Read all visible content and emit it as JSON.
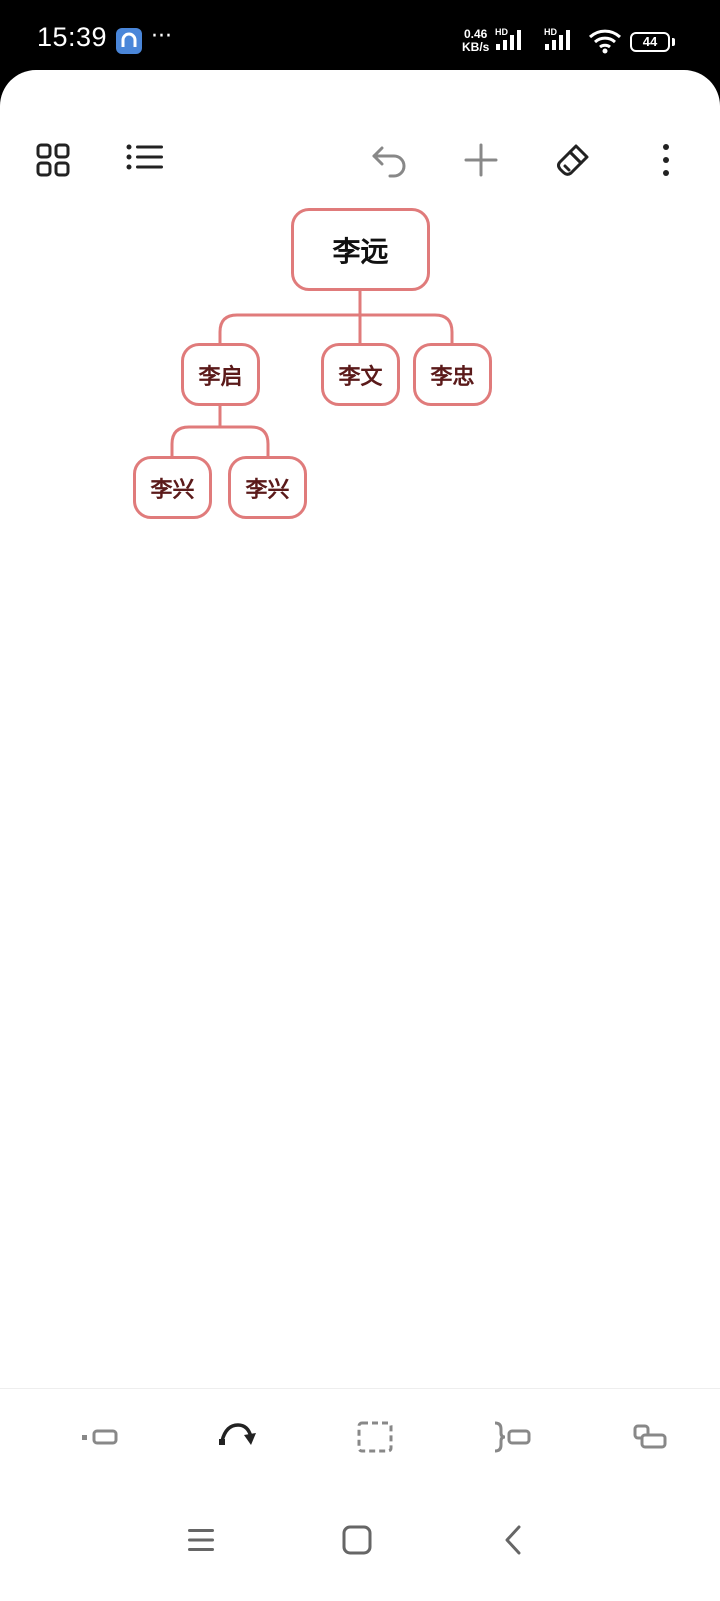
{
  "status_bar": {
    "time": "15:39",
    "menu": "···",
    "net_speed_value": "0.46",
    "net_speed_unit": "KB/s",
    "hd1": "HD",
    "hd2": "HD",
    "battery": "44"
  },
  "toolbar": {
    "icons": [
      "grid-icon",
      "list-icon",
      "undo-icon",
      "plus-icon",
      "brush-icon",
      "more-icon"
    ]
  },
  "mindmap": {
    "root": "李远",
    "children": [
      {
        "label": "李启",
        "children": [
          "李兴",
          "李兴"
        ]
      },
      {
        "label": "李文"
      },
      {
        "label": "李忠"
      }
    ],
    "colors": {
      "border": "#e07b7b",
      "link": "#e07b7b",
      "text": "#5b1a1a"
    }
  },
  "bottom_toolbar": {
    "icons": [
      "add-child-node-icon",
      "redo-icon",
      "select-box-icon",
      "summary-icon",
      "add-sibling-icon"
    ]
  },
  "nav_bar": {
    "icons": [
      "menu-icon",
      "home-icon",
      "back-icon"
    ]
  }
}
